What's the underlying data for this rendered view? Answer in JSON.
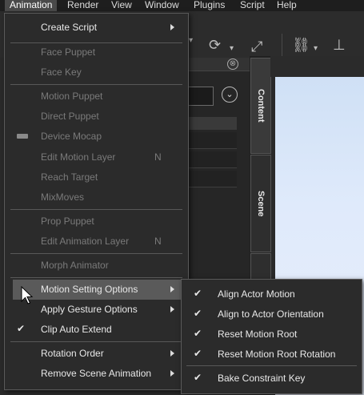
{
  "menubar": {
    "items": [
      "Animation",
      "Render",
      "View",
      "Window",
      "Plugins",
      "Script",
      "Help"
    ]
  },
  "menu": {
    "items": [
      {
        "label": "Create Script",
        "enabled": true,
        "submenu": true
      },
      {
        "label": "Face Puppet",
        "enabled": false
      },
      {
        "label": "Face Key",
        "enabled": false
      },
      {
        "label": "Motion Puppet",
        "enabled": false
      },
      {
        "label": "Direct Puppet",
        "enabled": false
      },
      {
        "label": "Device Mocap",
        "enabled": false
      },
      {
        "label": "Edit Motion Layer",
        "enabled": false,
        "shortcut": "N"
      },
      {
        "label": "Reach Target",
        "enabled": false
      },
      {
        "label": "MixMoves",
        "enabled": false
      },
      {
        "label": "Prop Puppet",
        "enabled": false
      },
      {
        "label": "Edit Animation Layer",
        "enabled": false,
        "shortcut": "N"
      },
      {
        "label": "Morph Animator",
        "enabled": false
      },
      {
        "label": "Motion Setting Options",
        "enabled": true,
        "submenu": true,
        "highlighted": true
      },
      {
        "label": "Apply Gesture Options",
        "enabled": true,
        "submenu": true
      },
      {
        "label": "Clip Auto Extend",
        "enabled": true,
        "checked": true
      },
      {
        "label": "Rotation Order",
        "enabled": true,
        "submenu": true
      },
      {
        "label": "Remove  Scene Animation",
        "enabled": true,
        "submenu": true
      }
    ]
  },
  "submenu": {
    "items": [
      {
        "label": "Align Actor Motion",
        "checked": true
      },
      {
        "label": "Align to Actor Orientation",
        "checked": true
      },
      {
        "label": "Reset Motion Root",
        "checked": true
      },
      {
        "label": "Reset Motion Root Rotation",
        "checked": true
      },
      {
        "label": "Bake Constraint Key",
        "checked": true
      }
    ]
  },
  "side_tabs": [
    "Content",
    "Scene"
  ],
  "glyphs": {
    "check": "✔",
    "close": "⊗",
    "dropdown": "⌄"
  }
}
